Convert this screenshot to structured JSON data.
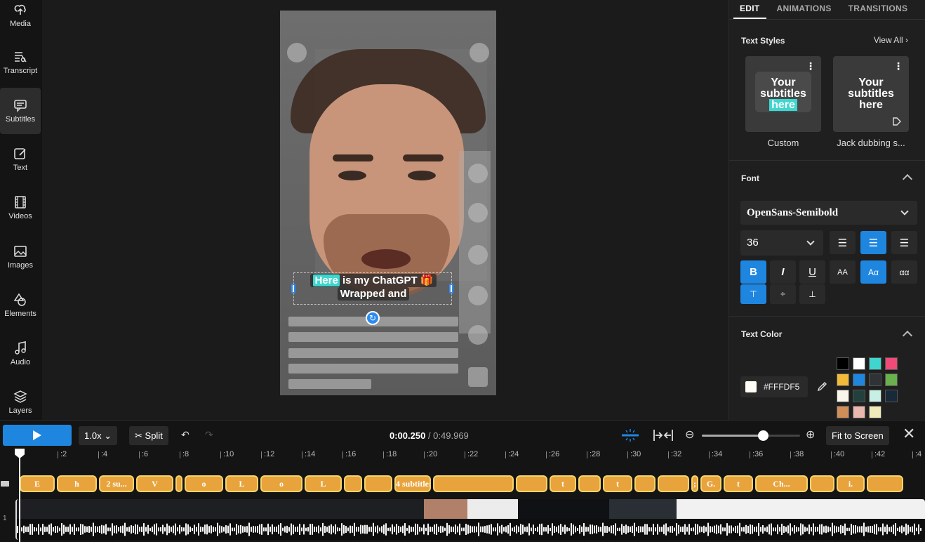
{
  "sidebar": {
    "items": [
      {
        "label": "Media",
        "icon": "upload-cloud-icon"
      },
      {
        "label": "Transcript",
        "icon": "transcript-icon"
      },
      {
        "label": "Subtitles",
        "icon": "subtitles-icon",
        "active": true
      },
      {
        "label": "Text",
        "icon": "text-edit-icon"
      },
      {
        "label": "Videos",
        "icon": "film-icon"
      },
      {
        "label": "Images",
        "icon": "image-icon"
      },
      {
        "label": "Elements",
        "icon": "shapes-icon"
      },
      {
        "label": "Audio",
        "icon": "music-note-icon"
      },
      {
        "label": "Layers",
        "icon": "layers-icon"
      }
    ]
  },
  "canvas": {
    "subtitle": {
      "highlight": "Here",
      "line1_rest": " is my ChatGPT 🎁",
      "line2": "Wrapped and"
    }
  },
  "panel": {
    "tabs": [
      "EDIT",
      "ANIMATIONS",
      "TRANSITIONS"
    ],
    "text_styles": {
      "title": "Text Styles",
      "view_all": "View All",
      "cards": [
        {
          "lines": [
            "Your",
            "subtitles",
            "here"
          ],
          "label": "Custom"
        },
        {
          "lines": [
            "Your",
            "subtitles",
            "here"
          ],
          "label": "Jack dubbing s..."
        }
      ]
    },
    "font": {
      "title": "Font",
      "family": "OpenSans-Semibold",
      "size": "36"
    },
    "text_color": {
      "title": "Text Color",
      "value": "#FFFDF5",
      "swatches": [
        "#000000",
        "#ffffff",
        "#3ed6cf",
        "#ef4a78",
        "#f2b93b",
        "#1f86e0",
        "#2f3336",
        "#6ab04c",
        "#fbf6ec",
        "#24403c",
        "#c8efe4",
        "#182a3a",
        "#d08f58",
        "#e9b7ad",
        "#f0ebb9"
      ]
    }
  },
  "timeline": {
    "speed": "1.0x",
    "split_label": "Split",
    "time_current": "0:00.250",
    "time_total": "/ 0:49.969",
    "fit_label": "Fit to Screen",
    "zoom": 0.62,
    "ruler": [
      ":2",
      ":4",
      ":6",
      ":8",
      ":10",
      ":12",
      ":14",
      ":16",
      ":18",
      ":20",
      ":22",
      ":24",
      ":26",
      ":28",
      ":30",
      ":32",
      ":34",
      ":36",
      ":38",
      ":40",
      ":42",
      ":4"
    ],
    "track_labels": [
      "1"
    ],
    "subtitle_segments": [
      "E",
      "h",
      "2 su...",
      "V",
      "",
      "o",
      "L",
      "o",
      "L",
      "",
      "",
      "4 subtitles (be ...",
      "",
      "",
      "t",
      "",
      "t",
      "",
      "",
      ";",
      "G.",
      "t",
      "Ch...",
      "",
      "i.",
      ""
    ]
  }
}
